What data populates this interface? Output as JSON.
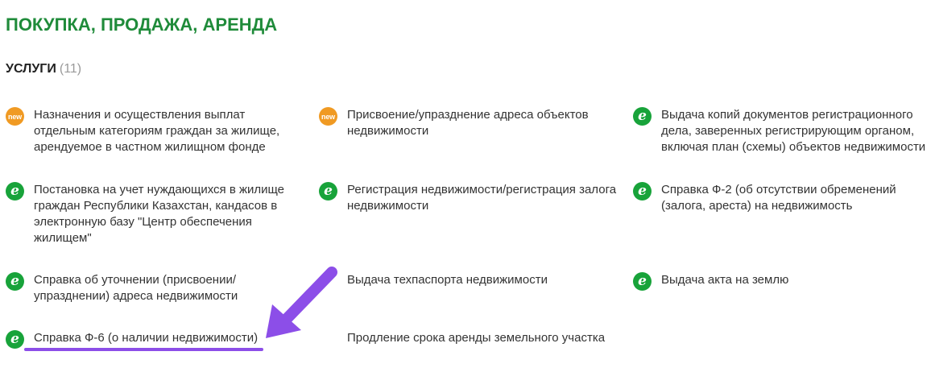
{
  "page": {
    "title": "ПОКУПКА, ПРОДАЖА, АРЕНДА",
    "section_title": "УСЛУГИ",
    "section_count": "(11)"
  },
  "colors": {
    "title_green": "#1f8b3a",
    "e_icon_green": "#18a33a",
    "new_badge_orange": "#f09a23",
    "annotation_purple": "#8c4ee8"
  },
  "services": [
    {
      "label": "Назначения и осуществления выплат отдельным категориям граждан за жилище, арендуемое в частном жилищном фонде",
      "icon": "new-badge-icon",
      "icon_text": "new"
    },
    {
      "label": "Присвоение/упразднение адреса объектов недвижимости",
      "icon": "new-badge-icon",
      "icon_text": "new"
    },
    {
      "label": "Выдача копий документов регистрационного дела, заверенных регистрирующим органом, включая план (схемы) объектов недвижимости",
      "icon": "e-service-icon",
      "icon_text": "e"
    },
    {
      "label": "Постановка на учет нуждающихся в жилище граждан Республики Казахстан, кандасов в электронную базу \"Центр обеспечения жилищем\"",
      "icon": "e-service-icon",
      "icon_text": "e"
    },
    {
      "label": "Регистрация недвижимости/регистрация залога недвижимости",
      "icon": "e-service-icon",
      "icon_text": "e"
    },
    {
      "label": "Справка Ф-2 (об отсутствии обременений (залога, ареста) на недвижимость",
      "icon": "e-service-icon",
      "icon_text": "e"
    },
    {
      "label": "Справка об уточнении (присвоении/ упразднении) адреса недвижимости",
      "icon": "e-service-icon",
      "icon_text": "e"
    },
    {
      "label": "Выдача техпаспорта недвижимости",
      "icon": "none"
    },
    {
      "label": "Выдача акта на землю",
      "icon": "e-service-icon",
      "icon_text": "e"
    },
    {
      "label": "Справка Ф-6 (о наличии недвижимости)",
      "icon": "e-service-icon",
      "icon_text": "e"
    },
    {
      "label": "Продление срока аренды земельного участка",
      "icon": "none"
    }
  ]
}
